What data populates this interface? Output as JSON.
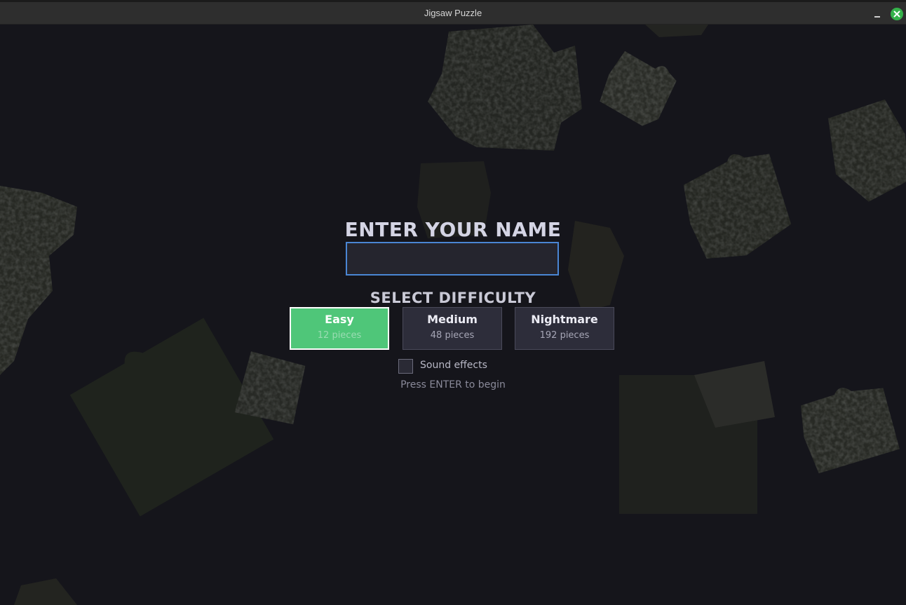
{
  "window": {
    "title": "Jigsaw Puzzle"
  },
  "menu": {
    "name_heading": "ENTER YOUR NAME",
    "name_value": "",
    "difficulty_heading": "SELECT DIFFICULTY",
    "difficulties": [
      {
        "label": "Easy",
        "pieces": "12 pieces",
        "selected": true
      },
      {
        "label": "Medium",
        "pieces": "48 pieces",
        "selected": false
      },
      {
        "label": "Nightmare",
        "pieces": "192 pieces",
        "selected": false
      }
    ],
    "sound_label": "Sound effects",
    "sound_checked": false,
    "hint": "Press ENTER to begin"
  },
  "colors": {
    "background": "#15151b",
    "selected": "#4fc679",
    "accent": "#4a86d4",
    "close": "#35b24a"
  }
}
